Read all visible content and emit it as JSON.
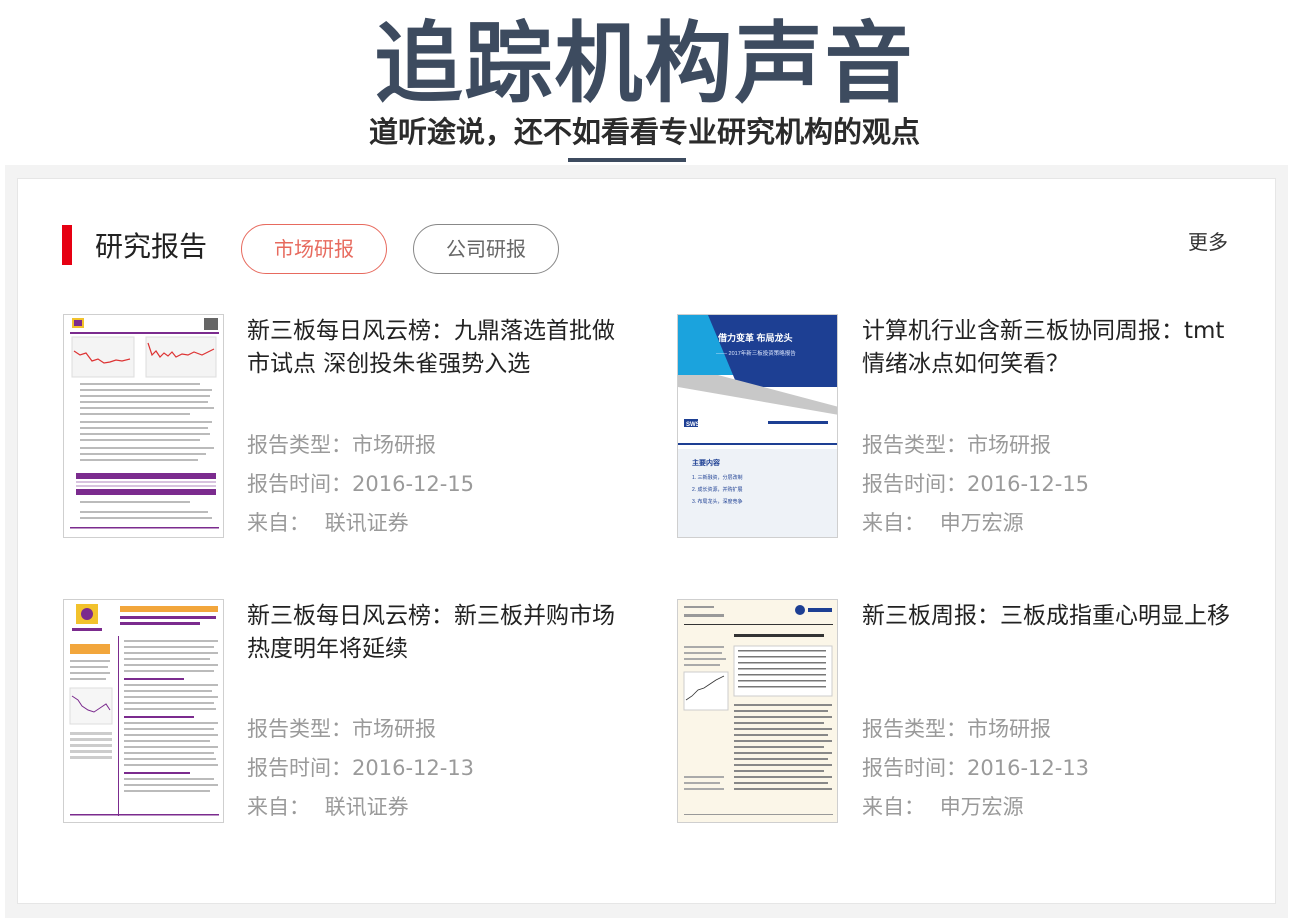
{
  "hero": {
    "title": "追踪机构声音",
    "subtitle": "道听途说，还不如看看专业研究机构的观点"
  },
  "section": {
    "title": "研究报告",
    "tabs": [
      {
        "label": "市场研报",
        "active": true
      },
      {
        "label": "公司研报",
        "active": false
      }
    ],
    "more_label": "更多"
  },
  "reports": [
    {
      "title": "新三板每日风云榜：九鼎落选首批做市试点 深创投朱雀强势入选",
      "type_label": "报告类型：市场研报",
      "date_label": "报告时间：2016-12-15",
      "source_prefix": "来自：",
      "source": "联讯证券"
    },
    {
      "title": "计算机行业含新三板协同周报：tmt情绪冰点如何笑看？",
      "type_label": "报告类型：市场研报",
      "date_label": "报告时间：2016-12-15",
      "source_prefix": "来自：",
      "source": "申万宏源"
    },
    {
      "title": "新三板每日风云榜：新三板并购市场热度明年将延续",
      "type_label": "报告类型：市场研报",
      "date_label": "报告时间：2016-12-13",
      "source_prefix": "来自：",
      "source": "联讯证券"
    },
    {
      "title": "新三板周报：三板成指重心明显上移",
      "type_label": "报告类型：市场研报",
      "date_label": "报告时间：2016-12-13",
      "source_prefix": "来自：",
      "source": "申万宏源"
    }
  ],
  "thumb2_text": {
    "headline": "借力变革 布局龙头",
    "subline": "—— 2017年新三板投资策略报告",
    "logo": "SWS",
    "toc_title": "主要内容",
    "toc": [
      "1. 三新融资，分层改制",
      "2. 成长资源，并购扩展",
      "3. 布局龙头，深度竞争"
    ]
  },
  "colors": {
    "accent_red": "#e60012",
    "tab_active": "#e76a5e",
    "hero_title": "#3d4b5f",
    "meta_gray": "#9a9a9a",
    "purple_report": "#7b2b8e",
    "sws_blue": "#1d3f93"
  }
}
